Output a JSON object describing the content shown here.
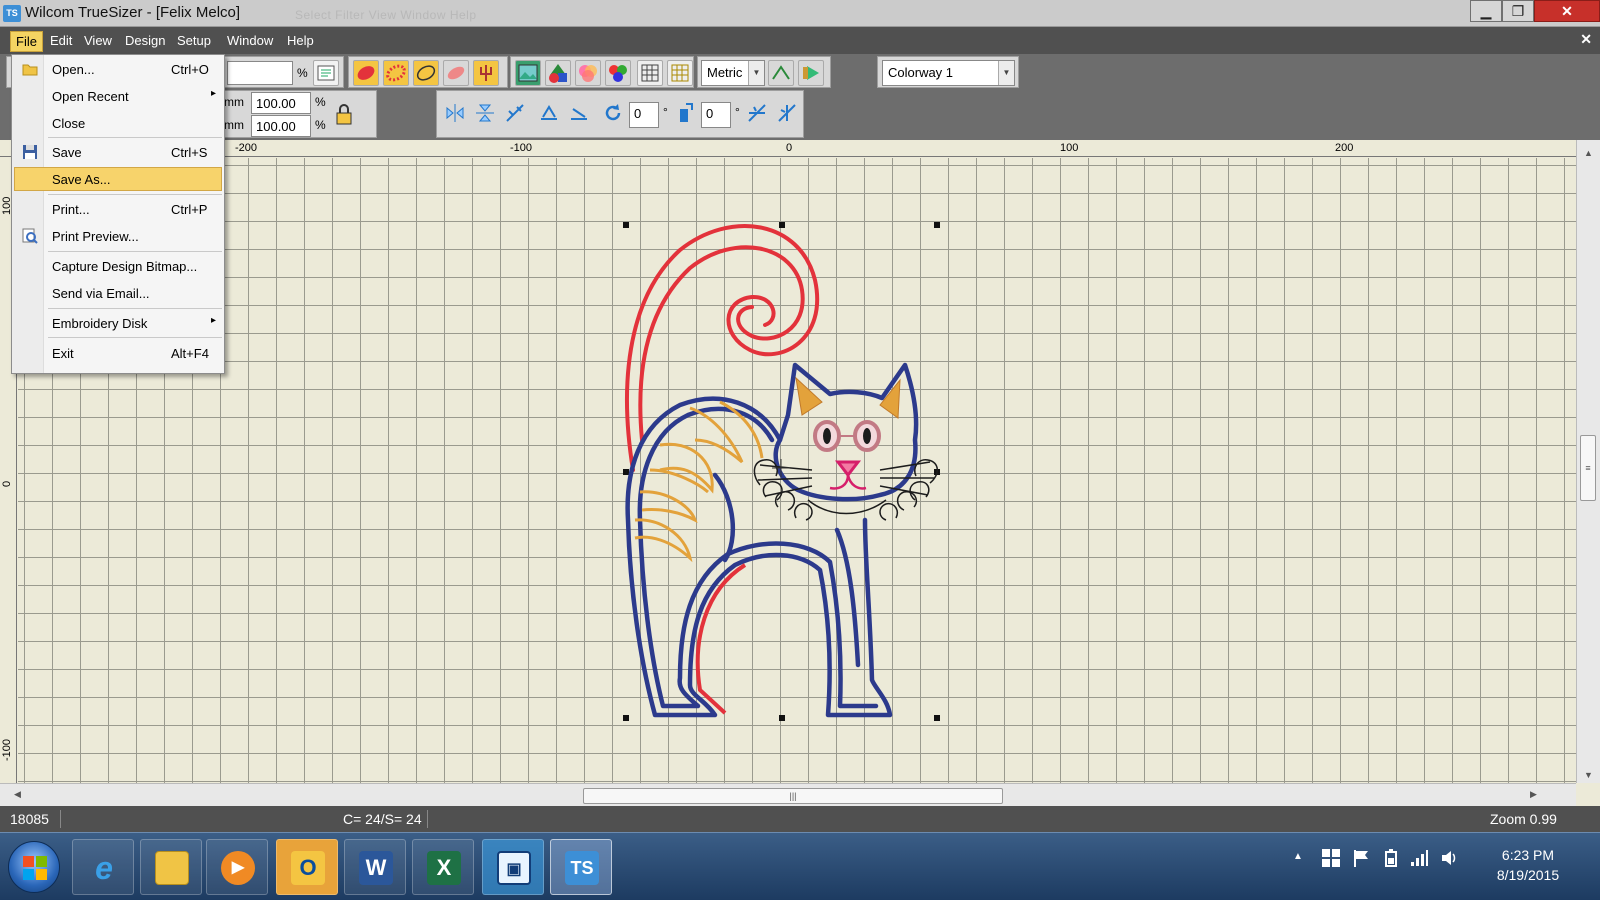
{
  "window": {
    "title": "Wilcom TrueSizer - [Felix            Melco]",
    "faded_menu": "Select   Filter   View   Window   Help",
    "minimize": "▁",
    "maximize": "❐",
    "close": "✕"
  },
  "menubar": {
    "items": [
      "File",
      "Edit",
      "View",
      "Design",
      "Setup",
      "Window",
      "Help"
    ],
    "active": "File",
    "mdi_close": "✕"
  },
  "toolbar": {
    "percent_sign": "%",
    "mm_label": "mm",
    "width_scale": "100.00",
    "height_scale": "100.00",
    "units": "Metric",
    "rotate_angle": "0",
    "slant_angle": "0",
    "colorway": "Colorway 1",
    "degree_sign": "°"
  },
  "file_menu": {
    "items": [
      {
        "label": "Open...",
        "shortcut": "Ctrl+O",
        "icon": "folder-open-icon"
      },
      {
        "label": "Open Recent",
        "submenu": true
      },
      {
        "label": "Close"
      },
      {
        "label": "Save",
        "shortcut": "Ctrl+S",
        "icon": "floppy-disk-icon"
      },
      {
        "label": "Save As...",
        "highlighted": true
      },
      {
        "label": "Print...",
        "shortcut": "Ctrl+P"
      },
      {
        "label": "Print Preview...",
        "icon": "magnifier-icon"
      },
      {
        "label": "Capture Design Bitmap..."
      },
      {
        "label": "Send via Email..."
      },
      {
        "label": "Embroidery Disk",
        "submenu": true
      },
      {
        "label": "Exit",
        "shortcut": "Alt+F4"
      }
    ],
    "submenu_arrow": "▸"
  },
  "rulers": {
    "horizontal_ticks": [
      "-200",
      "-100",
      "0",
      "100",
      "200"
    ],
    "vertical_ticks": [
      "100",
      "0",
      "-100"
    ]
  },
  "statusbar": {
    "stitch_count": "18085",
    "colors_stops": "C= 24/S= 24",
    "zoom": "Zoom 0.99"
  },
  "taskbar": {
    "apps": [
      "internet-explorer",
      "file-explorer",
      "media-player",
      "outlook",
      "word",
      "excel",
      "image-viewer",
      "truesizer"
    ],
    "truesizer_label": "TS",
    "time": "6:23 PM",
    "date": "8/19/2015",
    "tray_arrow": "▲"
  },
  "colors": {
    "thread_red": "#e3323b",
    "thread_navy": "#2c3a8c",
    "thread_gold": "#e3a23b",
    "thread_pink": "#d61f6a",
    "thread_rose": "#c27a84",
    "thread_black": "#1c1c1c",
    "menu_highlight": "#f7d36b"
  }
}
